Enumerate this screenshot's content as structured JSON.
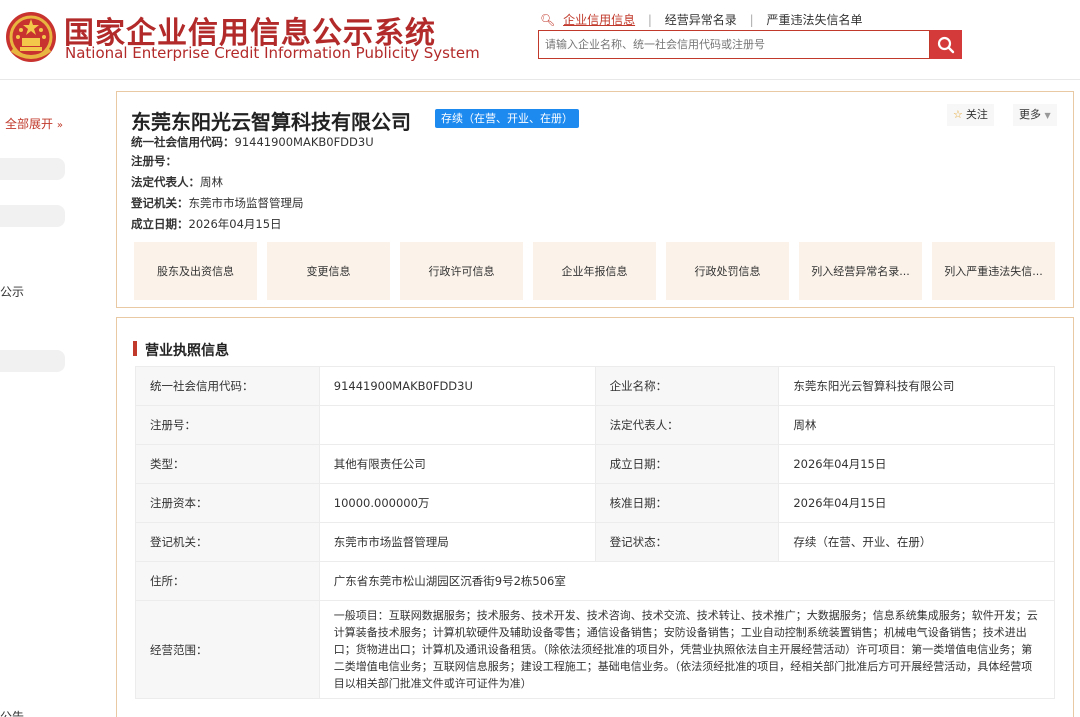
{
  "header": {
    "title_cn": "国家企业信用信息公示系统",
    "title_en": "National Enterprise Credit Information Publicity System",
    "nav": [
      {
        "label": "企业信用信息",
        "active": true
      },
      {
        "label": "经营异常名录",
        "active": false
      },
      {
        "label": "严重违法失信名单",
        "active": false
      }
    ],
    "search_placeholder": "请输入企业名称、统一社会信用代码或注册号",
    "accent_color": "#c0392b"
  },
  "sidebar": {
    "expand_label": "全部展开",
    "text_items": [
      "公示",
      "公告"
    ]
  },
  "company": {
    "name": "东莞东阳光云智算科技有限公司",
    "status": "存续（在营、开业、在册）",
    "follow_label": "关注",
    "more_label": "更多",
    "lines": [
      {
        "label": "统一社会信用代码：",
        "value": "91441900MAKB0FDD3U"
      },
      {
        "label": "注册号：",
        "value": ""
      },
      {
        "label": "法定代表人：",
        "value": "周林"
      },
      {
        "label": "登记机关：",
        "value": "东莞市市场监督管理局"
      },
      {
        "label": "成立日期：",
        "value": "2026年04月15日"
      }
    ],
    "tabs": [
      "股东及出资信息",
      "变更信息",
      "行政许可信息",
      "企业年报信息",
      "行政处罚信息",
      "列入经营异常名录...",
      "列入严重违法失信..."
    ]
  },
  "license": {
    "section_title": "营业执照信息",
    "rows": [
      {
        "l1": "统一社会信用代码：",
        "v1": "91441900MAKB0FDD3U",
        "l2": "企业名称：",
        "v2": "东莞东阳光云智算科技有限公司"
      },
      {
        "l1": "注册号：",
        "v1": "",
        "l2": "法定代表人：",
        "v2": "周林"
      },
      {
        "l1": "类型：",
        "v1": "其他有限责任公司",
        "l2": "成立日期：",
        "v2": "2026年04月15日"
      },
      {
        "l1": "注册资本：",
        "v1": "10000.000000万",
        "l2": "核准日期：",
        "v2": "2026年04月15日"
      },
      {
        "l1": "登记机关：",
        "v1": "东莞市市场监督管理局",
        "l2": "登记状态：",
        "v2": "存续（在营、开业、在册）"
      }
    ],
    "address_label": "住所：",
    "address_value": "广东省东莞市松山湖园区沉香街9号2栋506室",
    "scope_label": "经营范围：",
    "scope_value": "一般项目：互联网数据服务；技术服务、技术开发、技术咨询、技术交流、技术转让、技术推广；大数据服务；信息系统集成服务；软件开发；云计算装备技术服务；计算机软硬件及辅助设备零售；通信设备销售；安防设备销售；工业自动控制系统装置销售；机械电气设备销售；技术进出口；货物进出口；计算机及通讯设备租赁。（除依法须经批准的项目外，凭营业执照依法自主开展经营活动）许可项目：第一类增值电信业务；第二类增值电信业务；互联网信息服务；建设工程施工；基础电信业务。（依法须经批准的项目，经相关部门批准后方可开展经营活动，具体经营项目以相关部门批准文件或许可证件为准）"
  }
}
